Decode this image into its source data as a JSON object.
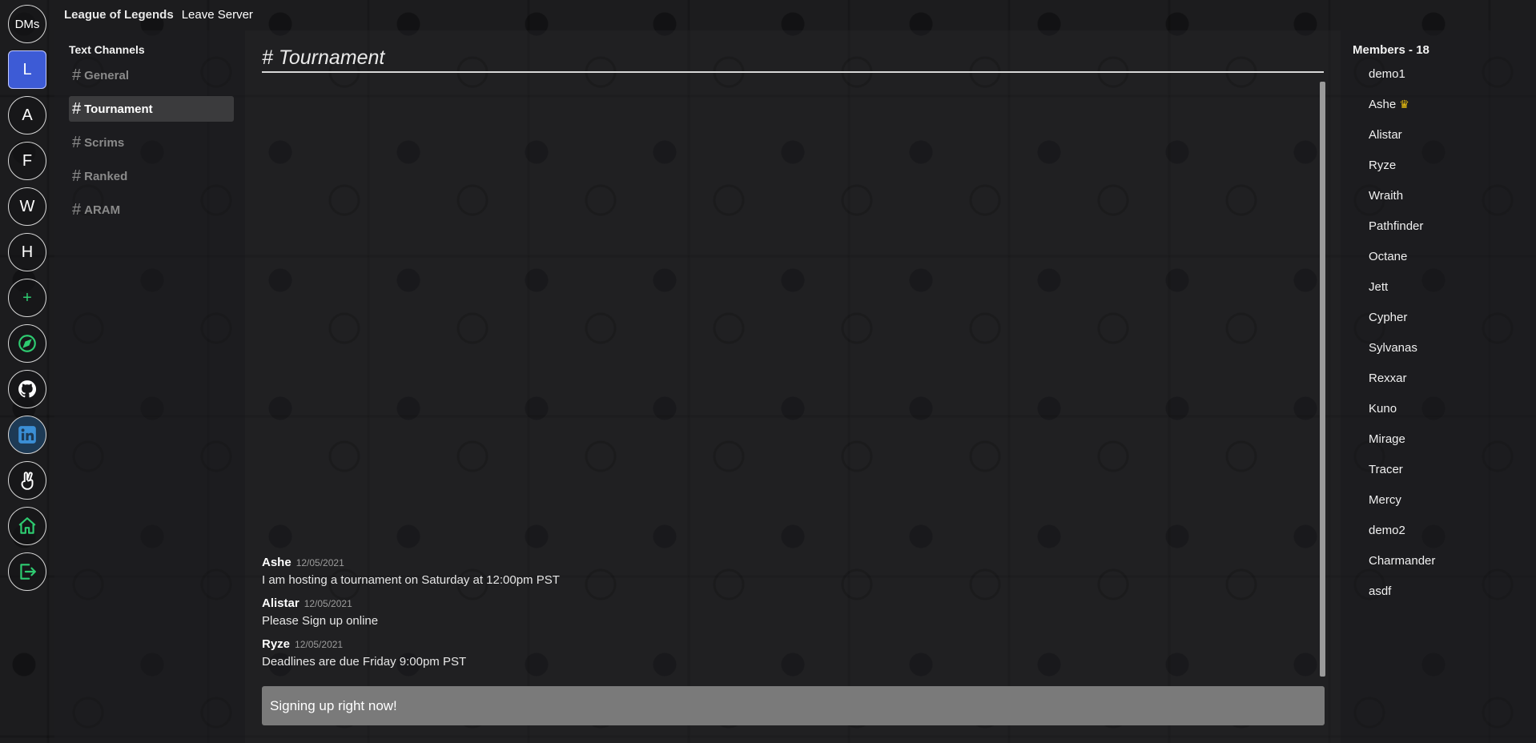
{
  "topbar": {
    "server_name": "League of Legends",
    "leave_label": "Leave Server"
  },
  "rail": {
    "dms_label": "DMs",
    "servers": [
      "L",
      "A",
      "F",
      "W",
      "H"
    ],
    "add_label": "+",
    "icons": [
      "compass-icon",
      "github-icon",
      "linkedin-icon",
      "peace-hand-icon",
      "home-icon",
      "logout-icon"
    ]
  },
  "channels": {
    "heading": "Text Channels",
    "items": [
      {
        "name": "General"
      },
      {
        "name": "Tournament"
      },
      {
        "name": "Scrims"
      },
      {
        "name": "Ranked"
      },
      {
        "name": "ARAM"
      }
    ],
    "active": "Tournament"
  },
  "chat": {
    "title": "# Tournament",
    "messages": [
      {
        "author": "Ashe",
        "date": "12/05/2021",
        "text": "I am hosting a tournament on Saturday at 12:00pm PST"
      },
      {
        "author": "Alistar",
        "date": "12/05/2021",
        "text": "Please Sign up online"
      },
      {
        "author": "Ryze",
        "date": "12/05/2021",
        "text": "Deadlines are due Friday 9:00pm PST"
      }
    ],
    "composer_value": "Signing up right now!"
  },
  "members": {
    "heading": "Members - 18",
    "list": [
      "demo1",
      "Ashe",
      "Alistar",
      "Ryze",
      "Wraith",
      "Pathfinder",
      "Octane",
      "Jett",
      "Cypher",
      "Sylvanas",
      "Rexxar",
      "Kuno",
      "Mirage",
      "Tracer",
      "Mercy",
      "demo2",
      "Charmander",
      "asdf"
    ],
    "owner_badge": "crown-icon"
  },
  "colors": {
    "active_server": "#3d5bd6",
    "accent_green": "#2ecc71",
    "crown": "#f1c40f"
  }
}
